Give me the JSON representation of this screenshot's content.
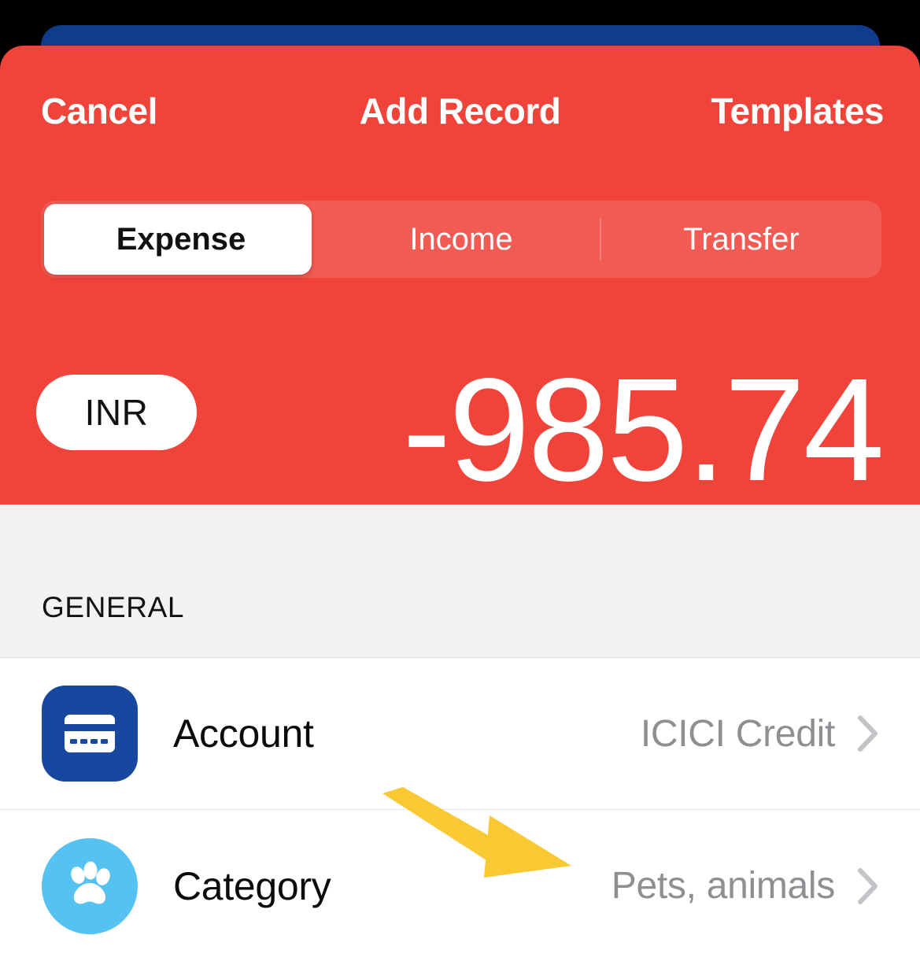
{
  "colors": {
    "accent_red": "#F0433A",
    "behind_blue": "#0F3D8C",
    "account_icon_blue": "#17479E",
    "category_icon_blue": "#55C2F1",
    "annotation_yellow": "#F9C933",
    "value_gray": "#8E8E93",
    "section_bg": "#F2F2F3"
  },
  "navbar": {
    "cancel_label": "Cancel",
    "title": "Add Record",
    "templates_label": "Templates"
  },
  "segmented": {
    "selected": "Expense",
    "options": [
      {
        "label": "Expense",
        "active": true
      },
      {
        "label": "Income",
        "active": false
      },
      {
        "label": "Transfer",
        "active": false
      }
    ]
  },
  "amount": {
    "currency": "INR",
    "value": "-985.74"
  },
  "sections": [
    {
      "header": "GENERAL",
      "rows": [
        {
          "icon": "credit-card-icon",
          "label": "Account",
          "value": "ICICI Credit",
          "chevron": "chevron-right-icon"
        },
        {
          "icon": "paw-print-icon",
          "label": "Category",
          "value": "Pets, animals",
          "chevron": "chevron-right-icon"
        }
      ]
    }
  ],
  "annotation": {
    "type": "arrow",
    "name": "yellow-annotation-arrow",
    "points_to": "Category value"
  }
}
